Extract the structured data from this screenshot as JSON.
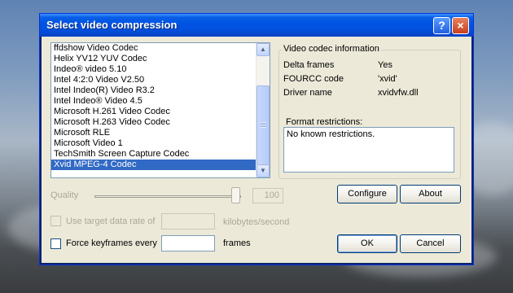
{
  "window": {
    "title": "Select video compression",
    "help_glyph": "?",
    "close_glyph": "×"
  },
  "codec_list": {
    "items": [
      "ffdshow Video Codec",
      "Helix YV12 YUV Codec",
      "Indeo® video 5.10",
      "Intel 4:2:0 Video V2.50",
      "Intel Indeo(R) Video R3.2",
      "Intel Indeo® Video 4.5",
      "Microsoft H.261 Video Codec",
      "Microsoft H.263 Video Codec",
      "Microsoft RLE",
      "Microsoft Video 1",
      "TechSmith Screen Capture Codec",
      "Xvid MPEG-4 Codec"
    ],
    "selected": "Xvid MPEG-4 Codec"
  },
  "codec_info": {
    "group_label": "Video codec information",
    "delta_frames_label": "Delta frames",
    "delta_frames_value": "Yes",
    "fourcc_label": "FOURCC code",
    "fourcc_value": "'xvid'",
    "driver_label": "Driver name",
    "driver_value": "xvidvfw.dll",
    "restrictions_label": "Format restrictions:",
    "restrictions_value": "No known restrictions."
  },
  "quality": {
    "label": "Quality",
    "value": "100"
  },
  "buttons": {
    "configure": "Configure",
    "about": "About",
    "ok": "OK",
    "cancel": "Cancel"
  },
  "data_rate": {
    "label": "Use target data rate of",
    "unit": "kilobytes/second",
    "value": ""
  },
  "keyframes": {
    "label": "Force keyframes every",
    "unit": "frames",
    "value": ""
  }
}
